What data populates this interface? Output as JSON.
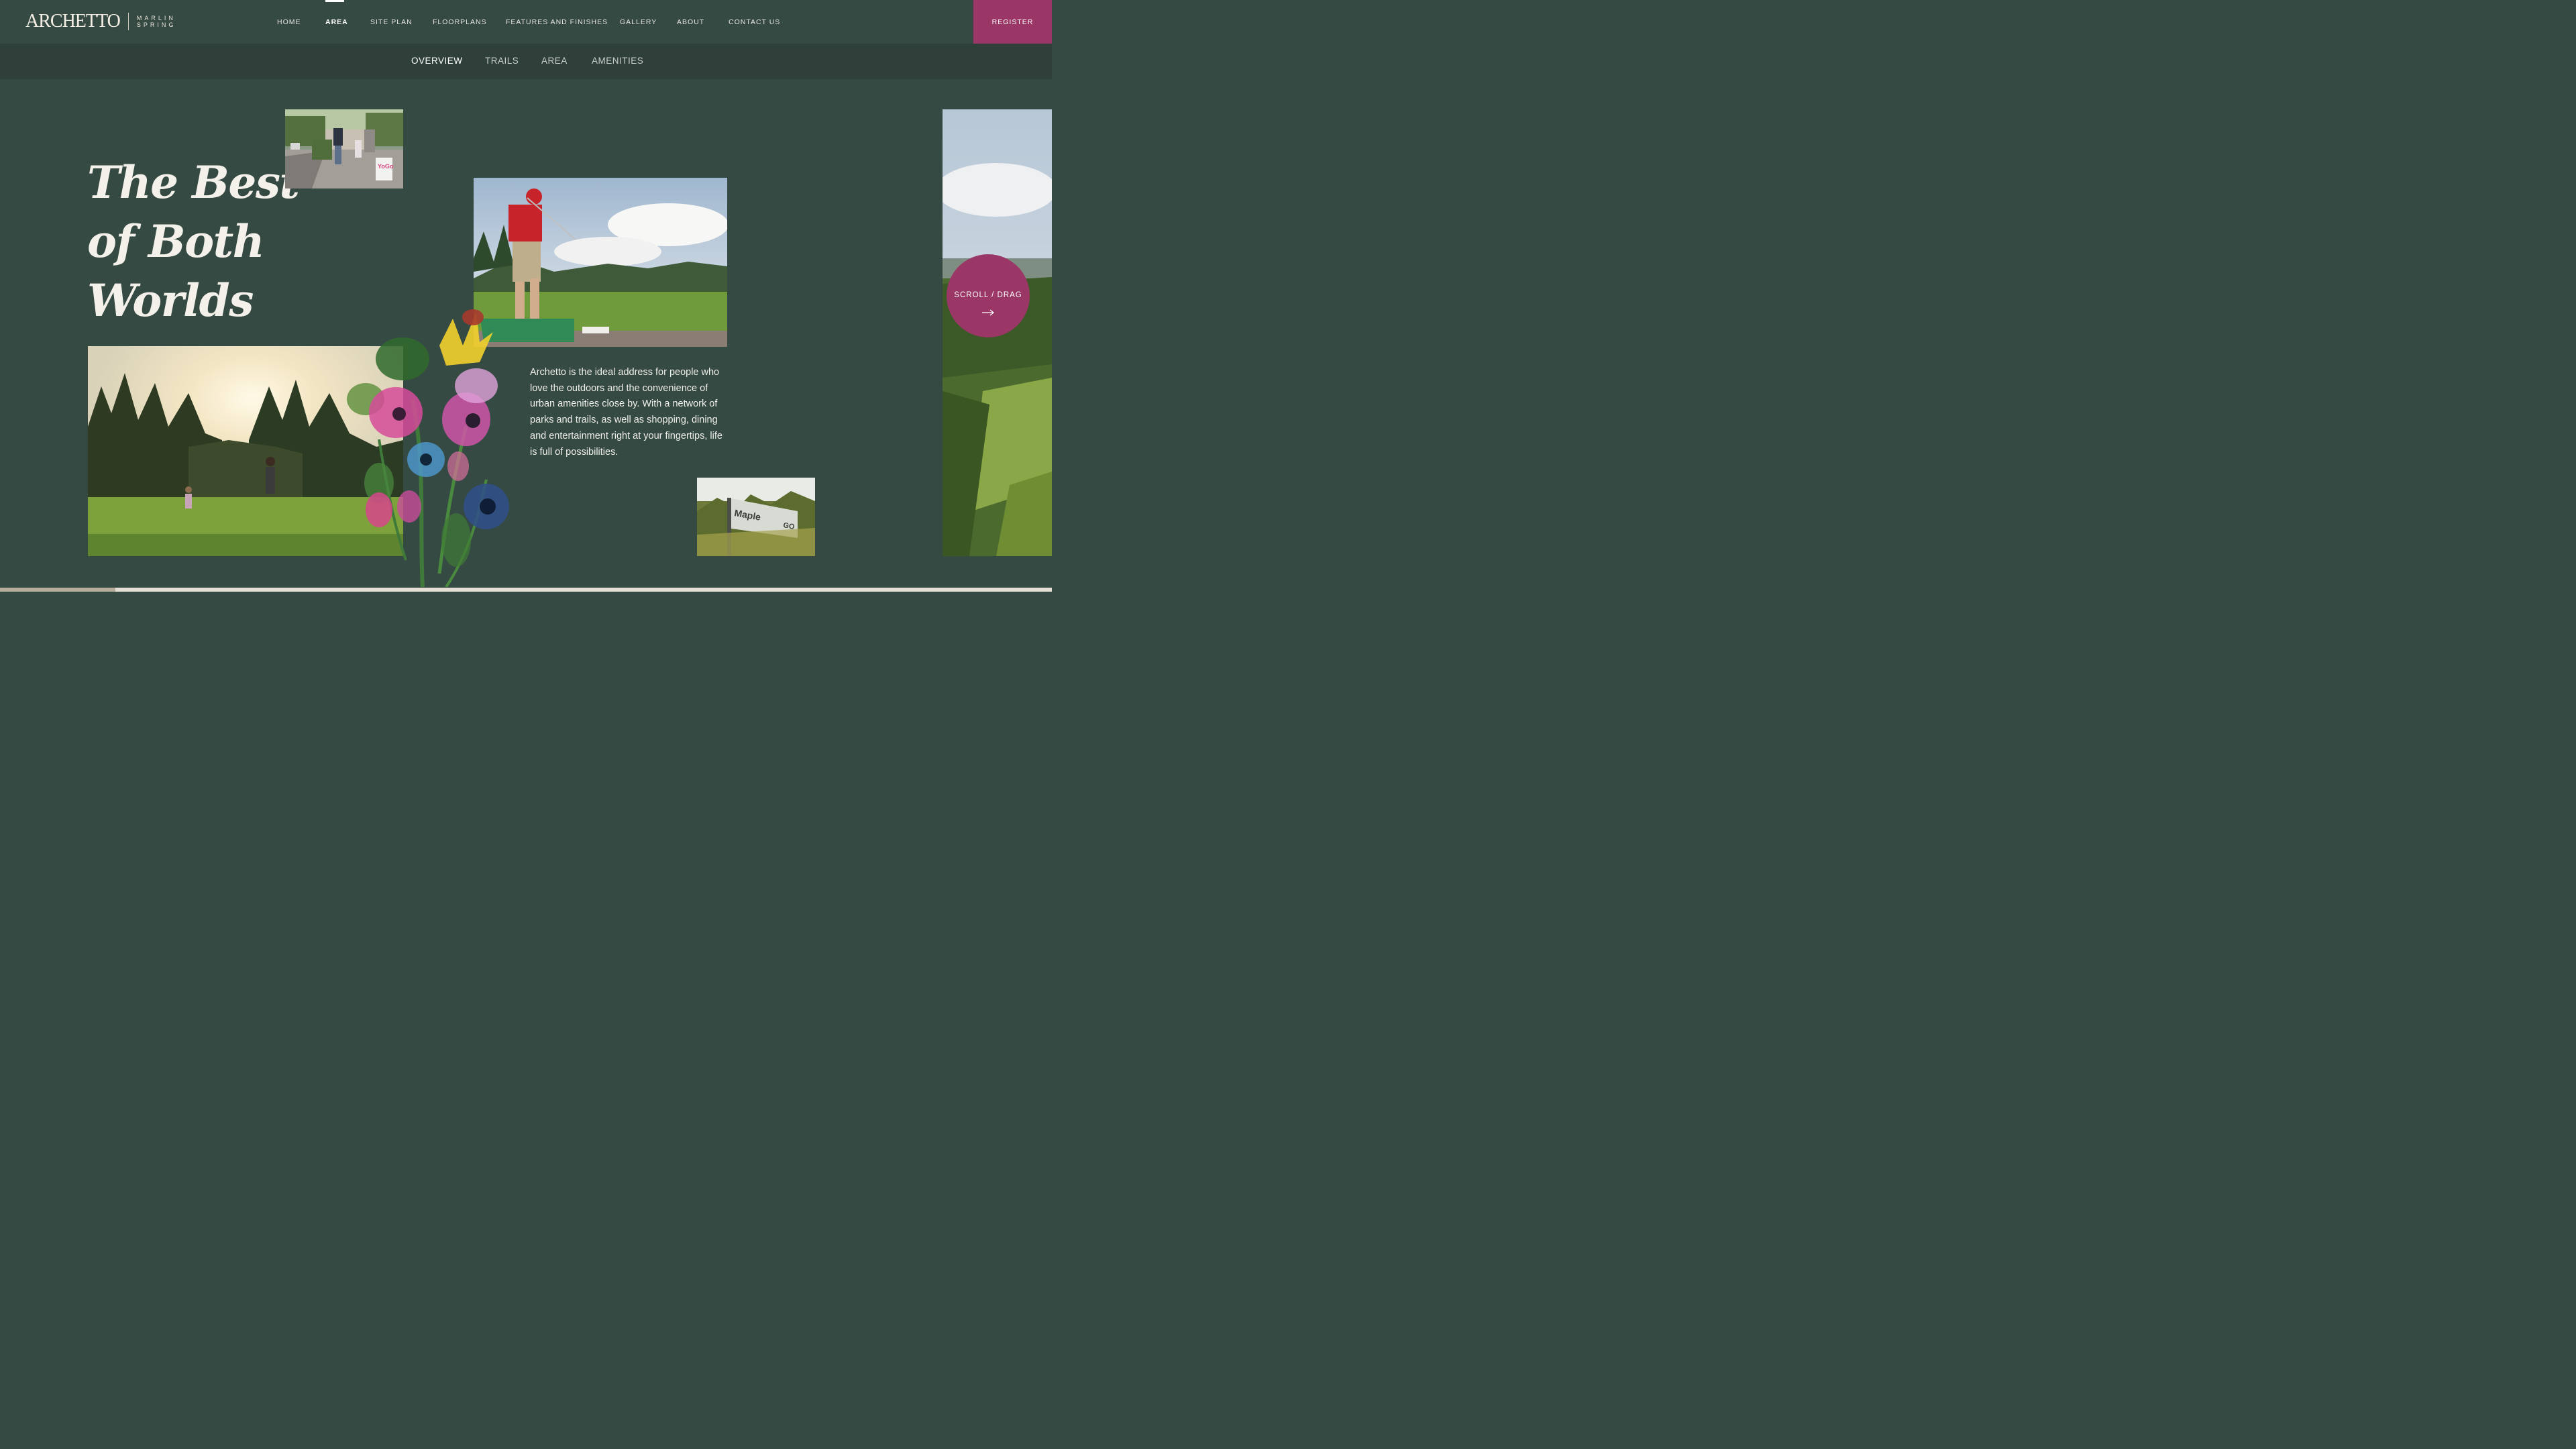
{
  "brand": {
    "name": "ARCHETTO",
    "sub_line1": "MARLIN",
    "sub_line2": "SPRING"
  },
  "nav": {
    "items": [
      {
        "label": "HOME"
      },
      {
        "label": "AREA",
        "active": true
      },
      {
        "label": "SITE PLAN"
      },
      {
        "label": "FLOORPLANS"
      },
      {
        "label": "FEATURES AND FINISHES"
      },
      {
        "label": "GALLERY"
      },
      {
        "label": "ABOUT"
      },
      {
        "label": "CONTACT US"
      }
    ],
    "register_label": "REGISTER"
  },
  "subnav": {
    "items": [
      {
        "label": "OVERVIEW",
        "active": true
      },
      {
        "label": "TRAILS"
      },
      {
        "label": "AREA"
      },
      {
        "label": "AMENITIES"
      }
    ]
  },
  "hero": {
    "headline_line1": "The Best",
    "headline_line2": "of Both Worlds",
    "body": "Archetto is the ideal address for people who love the outdoors and the convenience of urban amenities close by. With a network of parks and trails, as well as shopping, dining and entertainment right at your fingertips, life is full of possibilities."
  },
  "photos": {
    "street_sign_text": "YoGo",
    "station_sign_text": "Maple",
    "station_logo_text": "GO"
  },
  "scroll_button": {
    "label": "SCROLL / DRAG",
    "icon": "arrow-right-icon"
  },
  "progress": {
    "fraction": 0.11
  },
  "colors": {
    "background": "#364a44",
    "subnav_background": "#2f3f3a",
    "accent": "#9b3766",
    "text": "#f4f0ea"
  }
}
